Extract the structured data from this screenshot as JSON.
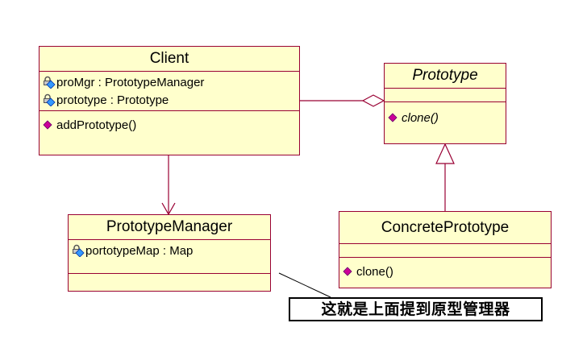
{
  "classes": {
    "client": {
      "name": "Client",
      "attributes": [
        {
          "text": "proMgr : PrototypeManager",
          "icon": "private-attribute-icon"
        },
        {
          "text": "prototype : Prototype",
          "icon": "private-attribute-icon"
        }
      ],
      "operations": [
        {
          "text": "addPrototype()",
          "icon": "public-operation-icon"
        }
      ]
    },
    "prototype": {
      "name": "Prototype",
      "abstract": true,
      "operations": [
        {
          "text": "clone()",
          "icon": "public-operation-icon",
          "abstract": true
        }
      ]
    },
    "manager": {
      "name": "PrototypeManager",
      "attributes": [
        {
          "text": "portotypeMap : Map",
          "icon": "private-attribute-icon"
        }
      ]
    },
    "concrete": {
      "name": "ConcretePrototype",
      "operations": [
        {
          "text": "clone()",
          "icon": "public-operation-icon"
        }
      ]
    }
  },
  "relationships": [
    {
      "from": "Client",
      "to": "Prototype",
      "kind": "aggregation"
    },
    {
      "from": "Client",
      "to": "PrototypeManager",
      "kind": "dependency"
    },
    {
      "from": "ConcretePrototype",
      "to": "Prototype",
      "kind": "generalization"
    }
  ],
  "note": {
    "text": "这就是上面提到原型管理器"
  },
  "colors": {
    "class_fill": "#ffffcc",
    "class_border": "#990033",
    "operation_icon": "#cc0099",
    "attribute_icon": "#3399ff"
  }
}
